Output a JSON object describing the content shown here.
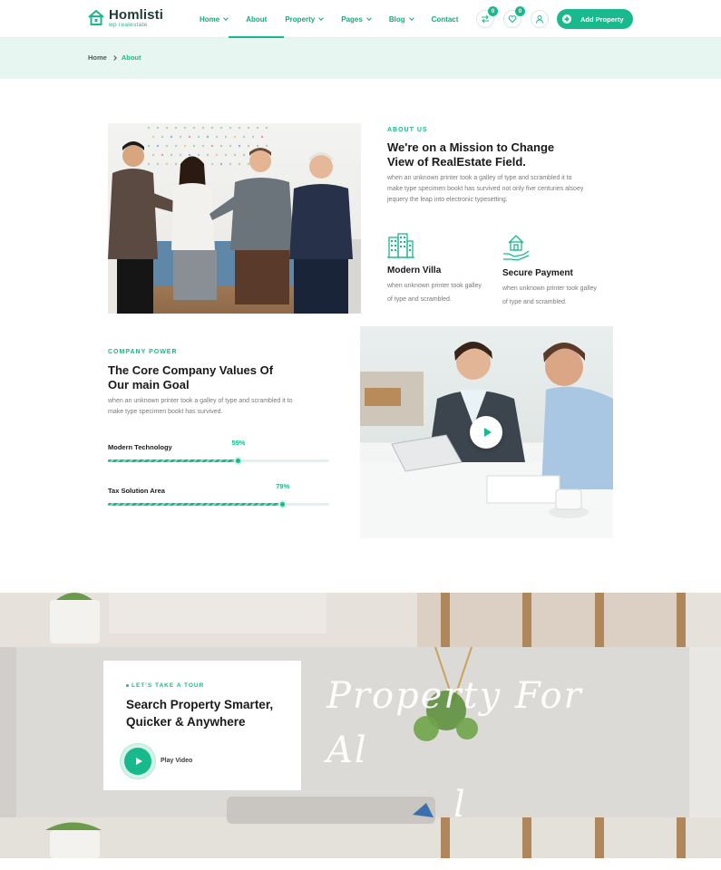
{
  "header": {
    "logo_title": "Homlisti",
    "logo_sub": "wp realestate",
    "nav": [
      {
        "label": "Home",
        "dropdown": true,
        "active": false
      },
      {
        "label": "About",
        "dropdown": false,
        "active": true
      },
      {
        "label": "Property",
        "dropdown": true,
        "active": false
      },
      {
        "label": "Pages",
        "dropdown": true,
        "active": false
      },
      {
        "label": "Blog",
        "dropdown": true,
        "active": false
      },
      {
        "label": "Contact",
        "dropdown": false,
        "active": false
      }
    ],
    "compare_count": "0",
    "wishlist_count": "0",
    "add_property_label": "Add Property"
  },
  "breadcrumb": {
    "home": "Home",
    "current": "About"
  },
  "about": {
    "eyebrow": "ABOUT US",
    "heading_line1": "We're on a Mission to Change",
    "heading_line2": "View of RealEstate Field.",
    "para_line1": "when an unknown printer took a galley of type and scrambled it to",
    "para_line2": "make type specimen bookt has survived not only five centuries alsoey",
    "para_line3": "jequery the leap into electronic typesetting.",
    "features": [
      {
        "icon": "building-icon",
        "title": "Modern Villa",
        "desc_line1": "when unknown printer took galley",
        "desc_line2": "of type and scrambled."
      },
      {
        "icon": "house-hand-icon",
        "title": "Secure Payment",
        "desc_line1": "when unknown printer took galley",
        "desc_line2": "of type and scrambled."
      }
    ]
  },
  "company": {
    "eyebrow": "COMPANY POWER",
    "heading_line1": "The Core Company Values Of",
    "heading_line2": "Our main Goal",
    "para_line1": "when an unknown printer took a galley of type and scrambled it to",
    "para_line2": "make type specimen bookt has survived.",
    "bars": [
      {
        "label": "Modern Technology",
        "percent_label": "59%",
        "value": 59
      },
      {
        "label": "Tax Solution Area",
        "percent_label": "79%",
        "value": 79
      }
    ]
  },
  "tour": {
    "eyebrow": "LET'S TAKE A TOUR",
    "title_line1": "Search Property Smarter,",
    "title_line2": "Quicker & Anywhere",
    "play_label": "Play Video",
    "script_line1": "Property For Al",
    "script_line2": "l"
  },
  "colors": {
    "accent": "#18b98c",
    "band": "#e8f6f2"
  }
}
